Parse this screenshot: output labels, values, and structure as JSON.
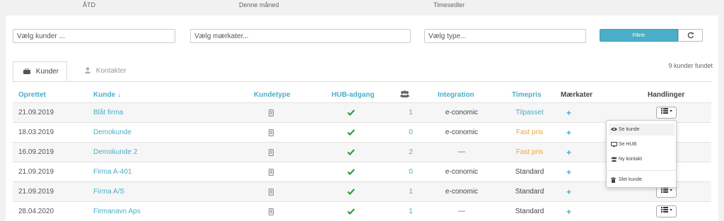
{
  "top_bar": {
    "atd": "ÅTD",
    "month": "Denne måned",
    "timesheets": "Timesedler"
  },
  "filters": {
    "customers_placeholder": "Vælg kunder ...",
    "tags_placeholder": "Vælg mærkater...",
    "type_placeholder": "Vælg type...",
    "filter_button": "Filtrér",
    "refresh_icon": "refresh-icon"
  },
  "tabs": [
    {
      "label": "Kunder",
      "icon": "briefcase-icon",
      "active": true
    },
    {
      "label": "Kontakter",
      "icon": "user-icon",
      "active": false
    }
  ],
  "result_count": "9 kunder fundet",
  "columns": {
    "created": "Oprettet",
    "customer": "Kunde ↓",
    "customer_type": "Kundetype",
    "hub_access": "HUB-adgang",
    "users_icon": "users-icon",
    "integration": "Integration",
    "hourly_rate": "Timepris",
    "tags": "Mærkater",
    "actions": "Handlinger"
  },
  "rows": [
    {
      "created": "21.09.2019",
      "customer": "Blåt firma",
      "users": "1",
      "integration": "e-conomic",
      "rate": "Tilpasset",
      "tag": "+"
    },
    {
      "created": "18.03.2019",
      "customer": "Demokunde",
      "users": "0",
      "integration": "e-conomic",
      "rate": "Fast pris",
      "tag": "+"
    },
    {
      "created": "16.09.2019",
      "customer": "Demokunde 2",
      "users": "2",
      "integration": "---",
      "rate": "Fast pris",
      "tag": "+"
    },
    {
      "created": "21.09.2019",
      "customer": "Firma A-401",
      "users": "0",
      "integration": "e-conomic",
      "rate": "Standard",
      "tag": "+"
    },
    {
      "created": "21.09.2019",
      "customer": "Firma A/S",
      "users": "1",
      "integration": "e-conomic",
      "rate": "Standard",
      "tag": "+"
    },
    {
      "created": "28.04.2020",
      "customer": "Firmanavn Aps",
      "users": "1",
      "integration": "---",
      "rate": "Standard",
      "tag": "+"
    }
  ],
  "dropdown_menu": {
    "view_customer": "Se kunde",
    "view_hub": "Se HUB",
    "new_contact": "Ny kontakt",
    "delete_customer": "Slet kunde"
  },
  "colors": {
    "accent": "#4aaec9",
    "check": "#2e9b3e",
    "orange": "#f0a33d"
  }
}
